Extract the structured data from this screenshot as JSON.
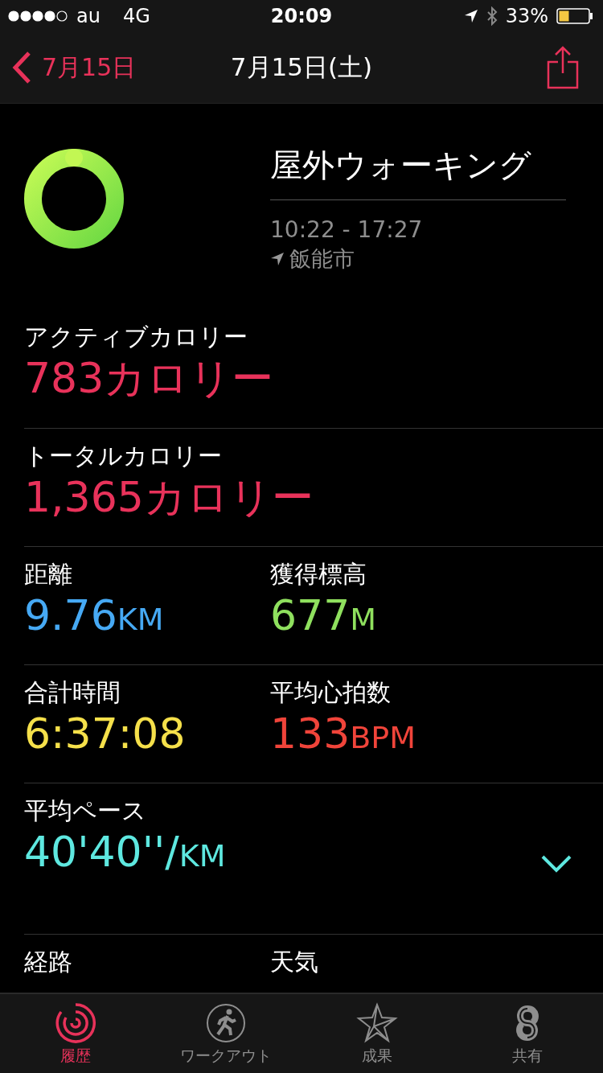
{
  "status_bar": {
    "carrier": "au",
    "network": "4G",
    "time": "20:09",
    "battery": "33%"
  },
  "nav": {
    "back": "7月15日",
    "title": "7月15日(土)"
  },
  "workout": {
    "title": "屋外ウォーキング",
    "time_range": "10:22 - 17:27",
    "location": "飯能市"
  },
  "stat_rows": [
    {
      "kind": "single",
      "stats": [
        {
          "label": "アクティブカロリー",
          "value": "783カロリー",
          "color": "#e8325a"
        }
      ]
    },
    {
      "kind": "single",
      "stats": [
        {
          "label": "トータルカロリー",
          "value": "1,365カロリー",
          "color": "#e8325a"
        }
      ]
    },
    {
      "kind": "pair",
      "stats": [
        {
          "label": "距離",
          "value": "9.76",
          "unit": "KM",
          "color": "#46a9f4"
        },
        {
          "label": "獲得標高",
          "value": "677",
          "unit": "M",
          "color": "#8fe05e"
        }
      ]
    },
    {
      "kind": "pair",
      "stats": [
        {
          "label": "合計時間",
          "value": "6:37:08",
          "color": "#f5e04a"
        },
        {
          "label": "平均心拍数",
          "value": "133",
          "unit": "BPM",
          "color": "#f0443a"
        }
      ]
    },
    {
      "kind": "expandable",
      "expanded": false,
      "stats": [
        {
          "label": "平均ペース",
          "value": "40'40''/",
          "unit": "KM",
          "color": "#5ee8e0"
        }
      ]
    },
    {
      "kind": "pair",
      "stats": [
        {
          "label": "経路"
        },
        {
          "label": "天気"
        }
      ]
    }
  ],
  "tabs": [
    {
      "label": "履歴",
      "selected": true
    },
    {
      "label": "ワークアウト",
      "selected": false
    },
    {
      "label": "成果",
      "selected": false
    },
    {
      "label": "共有",
      "selected": false
    }
  ]
}
